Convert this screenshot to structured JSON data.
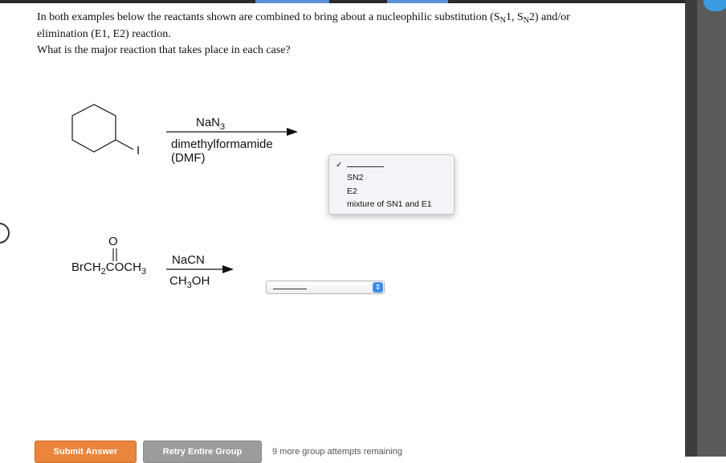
{
  "prompt": {
    "line1_a": "In both examples below the reactants shown are combined to bring about a nucleophilic substitution (S",
    "line1_sub1": "N",
    "line1_b": "1, S",
    "line1_sub2": "N",
    "line1_c": "2) and/or",
    "line2": "elimination (E1, E2) reaction.",
    "line3": "What is the major reaction that takes place in each case?"
  },
  "reaction1": {
    "substituent": "I",
    "reagent_main": "NaN",
    "reagent_main_sub": "3",
    "solvent_line1": "dimethylformamide",
    "solvent_line2": "(DMF)"
  },
  "reaction2": {
    "carbonyl_o": "O",
    "substrate_a": "BrCH",
    "substrate_sub1": "2",
    "substrate_b": "COCH",
    "substrate_sub2": "3",
    "reagent_main": "NaCN",
    "solvent_a": "CH",
    "solvent_sub": "3",
    "solvent_b": "OH"
  },
  "dropdown_open": {
    "selected_marker": "✓",
    "options": [
      "SN2",
      "E2",
      "mixture of SN1 and E1"
    ]
  },
  "buttons": {
    "submit": "Submit Answer",
    "retry": "Retry Entire Group"
  },
  "attempts_text": "9 more group attempts remaining",
  "colors": {
    "submit": "#e9853c",
    "retry": "#9c9c9c",
    "select_button": "#3b8ee8"
  }
}
